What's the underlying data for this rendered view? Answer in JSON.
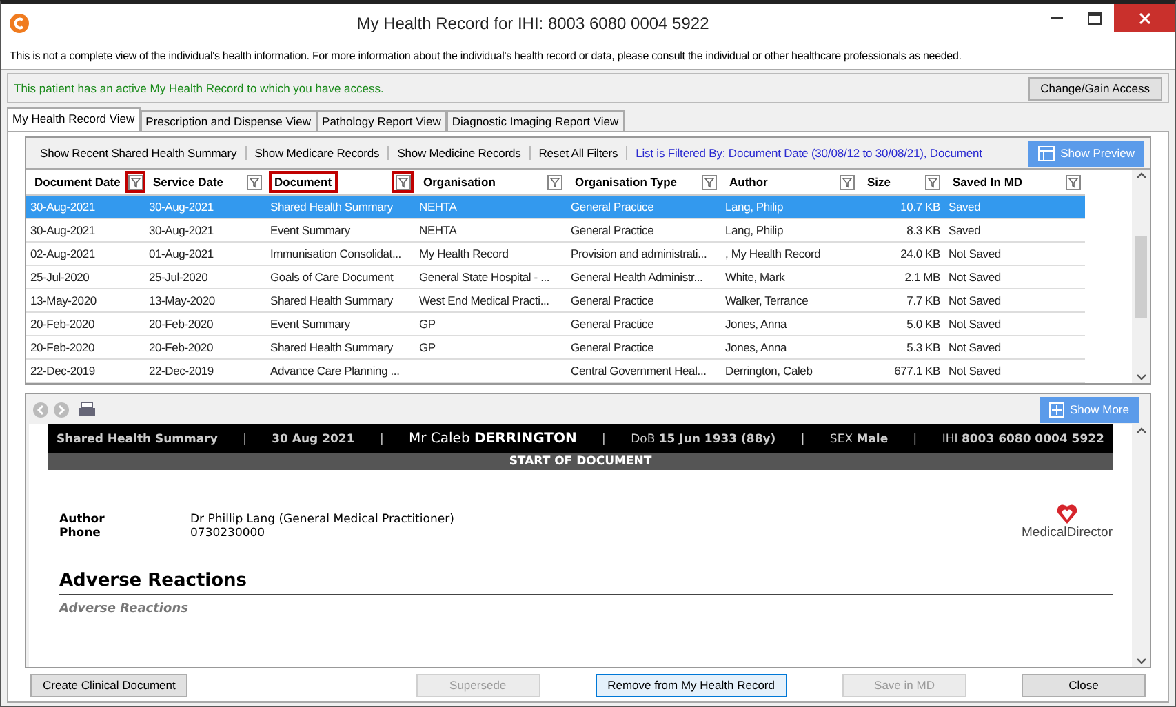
{
  "window": {
    "title": "My Health Record for IHI: 8003 6080 0004 5922"
  },
  "notice": "This is not a complete view of the individual's health information. For more information about the individual's health record or data, please consult the individual or other healthcare professionals as needed.",
  "access": {
    "message": "This patient has an active My Health Record to which you have access.",
    "button": "Change/Gain Access"
  },
  "tabs": [
    {
      "label": "My Health Record View",
      "selected": true
    },
    {
      "label": "Prescription and Dispense View",
      "selected": false
    },
    {
      "label": "Pathology Report View",
      "selected": false
    },
    {
      "label": "Diagnostic Imaging Report View",
      "selected": false
    }
  ],
  "toolbar": {
    "links": [
      "Show Recent Shared Health Summary",
      "Show Medicare Records",
      "Show Medicine Records",
      "Reset All Filters"
    ],
    "filter_text": "List is Filtered By: Document Date (30/08/12 to 30/08/21), Document",
    "preview_button": "Show Preview"
  },
  "table": {
    "columns": [
      {
        "label": "Document Date",
        "label_highlighted": false,
        "filter_highlighted": true
      },
      {
        "label": "Service Date",
        "label_highlighted": false,
        "filter_highlighted": false
      },
      {
        "label": "Document",
        "label_highlighted": true,
        "filter_highlighted": true
      },
      {
        "label": "Organisation",
        "label_highlighted": false,
        "filter_highlighted": false
      },
      {
        "label": "Organisation Type",
        "label_highlighted": false,
        "filter_highlighted": false
      },
      {
        "label": "Author",
        "label_highlighted": false,
        "filter_highlighted": false
      },
      {
        "label": "Size",
        "label_highlighted": false,
        "filter_highlighted": false
      },
      {
        "label": "Saved In MD",
        "label_highlighted": false,
        "filter_highlighted": false
      }
    ],
    "rows": [
      {
        "selected": true,
        "cells": [
          "30-Aug-2021",
          "30-Aug-2021",
          "Shared Health Summary",
          "NEHTA",
          "General Practice",
          "Lang, Philip",
          "10.7 KB",
          "Saved"
        ]
      },
      {
        "selected": false,
        "cells": [
          "30-Aug-2021",
          "30-Aug-2021",
          "Event Summary",
          "NEHTA",
          "General Practice",
          "Lang, Philip",
          "8.3 KB",
          "Saved"
        ]
      },
      {
        "selected": false,
        "cells": [
          "02-Aug-2021",
          "01-Aug-2021",
          "Immunisation Consolidat...",
          "My Health Record",
          "Provision and administrati...",
          ", My Health Record",
          "24.0 KB",
          "Not Saved"
        ]
      },
      {
        "selected": false,
        "cells": [
          "25-Jul-2020",
          "25-Jul-2020",
          "Goals of Care Document",
          "General State Hospital - ...",
          "General Health Administr...",
          "White, Mark",
          "2.1 MB",
          "Not Saved"
        ]
      },
      {
        "selected": false,
        "cells": [
          "13-May-2020",
          "13-May-2020",
          "Shared Health Summary",
          "West End Medical Practi...",
          "General Practice",
          "Walker, Terrance",
          "7.7 KB",
          "Not Saved"
        ]
      },
      {
        "selected": false,
        "cells": [
          "20-Feb-2020",
          "20-Feb-2020",
          "Event Summary",
          "GP",
          "General Practice",
          "Jones, Anna",
          "5.0 KB",
          "Not Saved"
        ]
      },
      {
        "selected": false,
        "cells": [
          "20-Feb-2020",
          "20-Feb-2020",
          "Shared Health Summary",
          "GP",
          "General Practice",
          "Jones, Anna",
          "5.3 KB",
          "Not Saved"
        ]
      },
      {
        "selected": false,
        "cells": [
          "22-Dec-2019",
          "22-Dec-2019",
          "Advance Care Planning ...",
          "",
          "Central Government Heal...",
          "Derrington, Caleb",
          "677.1 KB",
          "Not Saved"
        ]
      }
    ]
  },
  "preview": {
    "show_more_button": "Show More",
    "header": [
      {
        "kind": "text",
        "text": "**Shared Health Summary**"
      },
      {
        "kind": "separator",
        "text": "|"
      },
      {
        "kind": "text",
        "text": "**30 Aug 2021**"
      },
      {
        "kind": "separator",
        "text": "|"
      },
      {
        "kind": "name",
        "text": "Mr Caleb **DERRINGTON**"
      },
      {
        "kind": "separator",
        "text": "|"
      },
      {
        "kind": "text",
        "text": "DoB **15 Jun 1933 (88y)**"
      },
      {
        "kind": "separator",
        "text": "|"
      },
      {
        "kind": "text",
        "text": "SEX **Male**"
      },
      {
        "kind": "separator",
        "text": "|"
      },
      {
        "kind": "text",
        "text": "IHI **8003 6080 0004 5922**"
      }
    ],
    "banner": "START OF DOCUMENT",
    "fields": [
      {
        "label": "Author",
        "value": "Dr Phillip Lang (General Medical Practitioner)"
      },
      {
        "label": "Phone",
        "value": "0730230000"
      }
    ],
    "logo_text": "MedicalDirector",
    "section_heading": "Adverse Reactions",
    "section_subheading": "Adverse Reactions"
  },
  "buttons": [
    {
      "label": "Create Clinical Document",
      "disabled": false,
      "default": false
    },
    {
      "label": "Supersede",
      "disabled": true,
      "default": false
    },
    {
      "label": "Remove from My Health Record",
      "disabled": false,
      "default": true
    },
    {
      "label": "Save in MD",
      "disabled": true,
      "default": false
    },
    {
      "label": "Close",
      "disabled": false,
      "default": false
    }
  ]
}
